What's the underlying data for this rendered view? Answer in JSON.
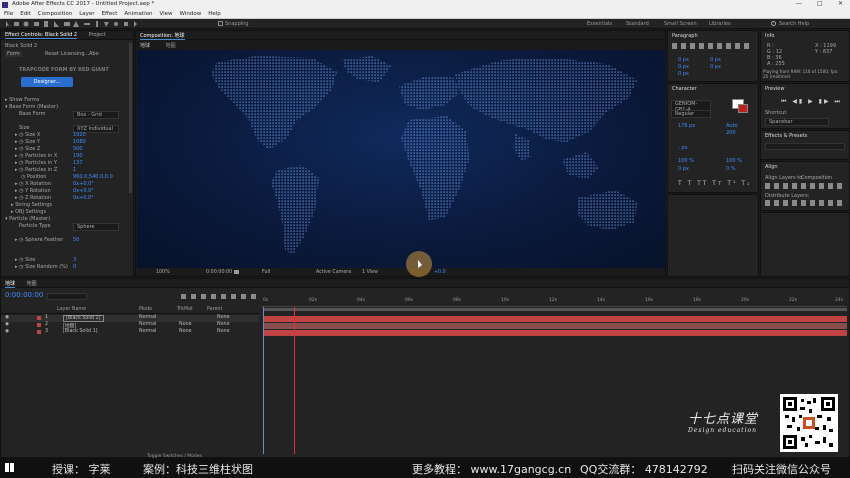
{
  "app": {
    "title": "Adobe After Effects CC 2017 - Untitled Project.aep *",
    "controls": [
      "—",
      "□",
      "✕"
    ]
  },
  "menu": [
    "File",
    "Edit",
    "Composition",
    "Layer",
    "Effect",
    "Animation",
    "View",
    "Window",
    "Help"
  ],
  "toolbar": {
    "snapping": "Snapping",
    "workspaces": [
      "Essentials",
      "Standard",
      "Small Screen",
      "Libraries"
    ],
    "search_placeholder": "Search Help"
  },
  "effect_controls": {
    "tabs": [
      "Effect Controls: Black Solid 2",
      "Project"
    ],
    "layer": "Black Solid 2",
    "fx_name": "Form",
    "reset": "Reset",
    "licensing": "Licensing...",
    "about": "Abo",
    "brand": "TRAPCODE FORM BY RED GIANT",
    "designer_button": "Designer...",
    "rows": [
      {
        "label": "Show Forms",
        "value": ""
      },
      {
        "label": "Base Form (Master)",
        "value": ""
      },
      {
        "label": "Base Form",
        "value": "Box - Grid"
      },
      {
        "label": "Size",
        "value": "XYZ Individual"
      },
      {
        "label": "Size X",
        "value": "1920"
      },
      {
        "label": "Size Y",
        "value": "1080"
      },
      {
        "label": "Size Z",
        "value": "500"
      },
      {
        "label": "Particles in X",
        "value": "190"
      },
      {
        "label": "Particles in Y",
        "value": "137"
      },
      {
        "label": "Particles in Z",
        "value": "1"
      },
      {
        "label": "Position",
        "value": "960.0,540.0,0.0"
      },
      {
        "label": "X Rotation",
        "value": "0x+0.0°"
      },
      {
        "label": "Y Rotation",
        "value": "0x+0.0°"
      },
      {
        "label": "Z Rotation",
        "value": "0x+0.0°"
      },
      {
        "label": "String Settings",
        "value": ""
      },
      {
        "label": "OBJ Settings",
        "value": ""
      },
      {
        "label": "Particle (Master)",
        "value": ""
      },
      {
        "label": "Particle Type",
        "value": "Sphere"
      },
      {
        "label": "Sphere Feather",
        "value": "50"
      },
      {
        "label": "Size",
        "value": "3"
      },
      {
        "label": "Size Random (%)",
        "value": "0"
      }
    ]
  },
  "composition": {
    "tab": "Composition: 地球",
    "subtabs": [
      "地球",
      "地图"
    ],
    "zoom": "100%",
    "timecode": "0:00:00:00",
    "resolution": "Full",
    "camera": "Active Camera",
    "views": "1 View",
    "exposure": "+0.0"
  },
  "right_panels": {
    "paragraph_title": "Paragraph",
    "paragraph_values": [
      "0 px",
      "0 px",
      "0 px",
      "0 px",
      "0 px"
    ],
    "info_title": "Info",
    "info_values": [
      "R :",
      "G : 12",
      "B : 36",
      "A : 255",
      "X : 1199",
      "Y : 837"
    ],
    "info_note": "Playing from RAM: 116 of 1500; fps: 25 (realtime)",
    "character_title": "Character",
    "font": "GENIOM-GB1-4",
    "font_style": "Regular",
    "font_size": "176 px",
    "kerning": "Auto",
    "tracking": "200",
    "leading": "- px",
    "vscale": "100 %",
    "hscale": "100 %",
    "baseline": "0 px",
    "tsume": "0 %",
    "preview_title": "Preview",
    "shortcut_label": "Shortcut",
    "shortcut_value": "Spacebar",
    "effects_title": "Effects & Presets",
    "align_title": "Align",
    "align_layers_to": "Align Layers to:",
    "align_target": "Composition",
    "distribute_layers": "Distribute Layers:"
  },
  "timeline": {
    "tabs": [
      "地球",
      "地图"
    ],
    "timecode": "0:00:00:00",
    "headers": {
      "layer_name": "Layer Name",
      "mode": "Mode",
      "trkmat": "TrkMat",
      "parent": "Parent"
    },
    "layers": [
      {
        "num": "1",
        "name": "[Black Solid 2]",
        "mode": "Normal",
        "trkmat": "",
        "parent": "None"
      },
      {
        "num": "2",
        "name": "[地图]",
        "mode": "Normal",
        "trkmat": "None",
        "parent": "None"
      },
      {
        "num": "3",
        "name": "[Black Solid 1]",
        "mode": "Normal",
        "trkmat": "None",
        "parent": "None"
      }
    ],
    "ruler": [
      "0s",
      "02s",
      "04s",
      "06s",
      "08s",
      "10s",
      "12s",
      "14s",
      "16s",
      "18s",
      "20s",
      "22s",
      "24s"
    ],
    "footer": "Toggle Switches / Modes"
  },
  "watermark": {
    "logo_text": "十七点课堂",
    "subtext": "Design education"
  },
  "banner": {
    "lecturer": "授课：  字莱",
    "case": "案例：科技三维柱状图",
    "more": "更多教程：  www.17gangcg.cn",
    "qq": "QQ交流群：  478142792",
    "wechat": "扫码关注微信公众号"
  }
}
